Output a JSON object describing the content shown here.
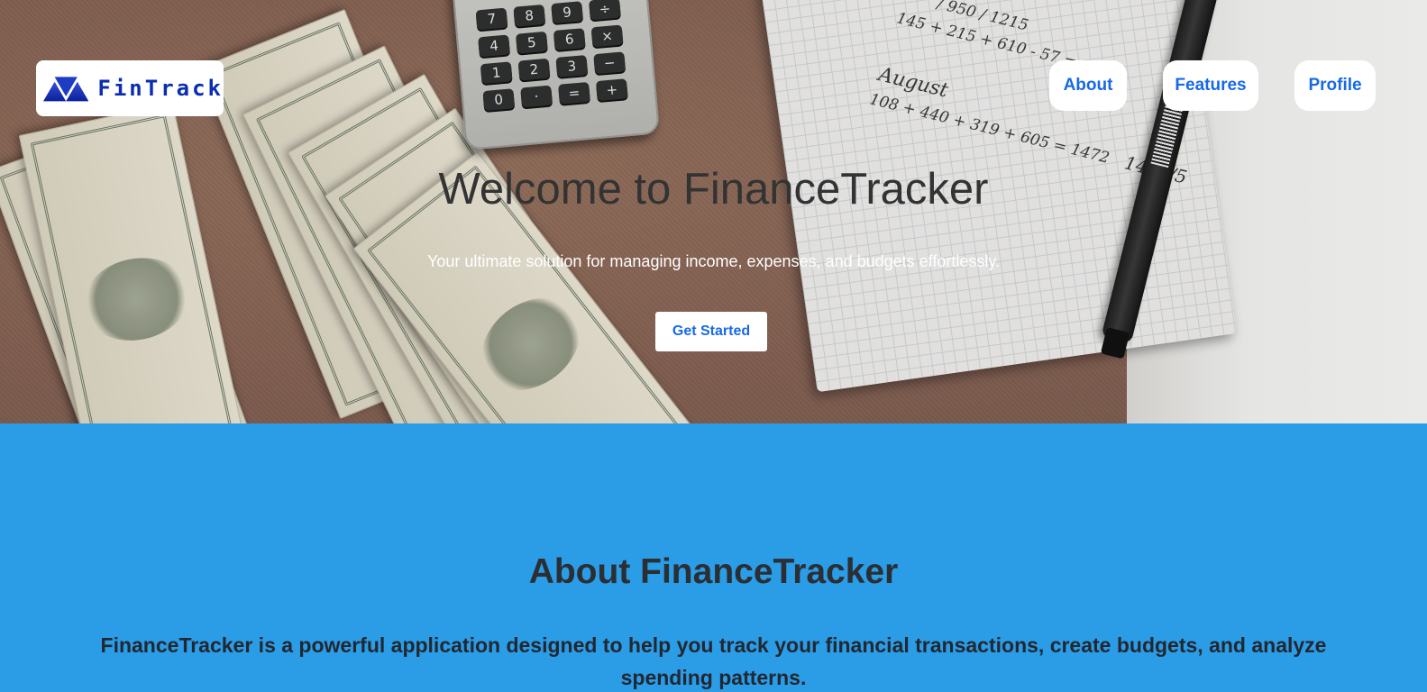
{
  "brand": {
    "logo_text": "FinTrack",
    "logo_icon": "double-triangle-icon",
    "color": "#0b2db3"
  },
  "nav": {
    "items": [
      {
        "label": "About"
      },
      {
        "label": "Features"
      },
      {
        "label": "Profile"
      }
    ]
  },
  "hero": {
    "title": "Welcome to FinanceTracker",
    "subtitle": "Your ultimate solution for managing income, expenses, and budgets effortlessly.",
    "cta_label": "Get Started",
    "calculator_keys": [
      "7",
      "8",
      "9",
      "÷",
      "4",
      "5",
      "6",
      "×",
      "1",
      "2",
      "3",
      "−",
      "0",
      "·",
      "=",
      "+"
    ],
    "handwriting": [
      "/ 950 / 1215",
      "145 + 215 + 610 - 57 =",
      "August",
      "108 + 440 + 319 + 605 = 1472",
      "1472/5"
    ]
  },
  "about": {
    "title": "About FinanceTracker",
    "text": "FinanceTracker is a powerful application designed to help you track your financial transactions, create budgets, and analyze spending patterns."
  },
  "colors": {
    "accent": "#1769e6",
    "about_bg": "#2b9ce6"
  }
}
